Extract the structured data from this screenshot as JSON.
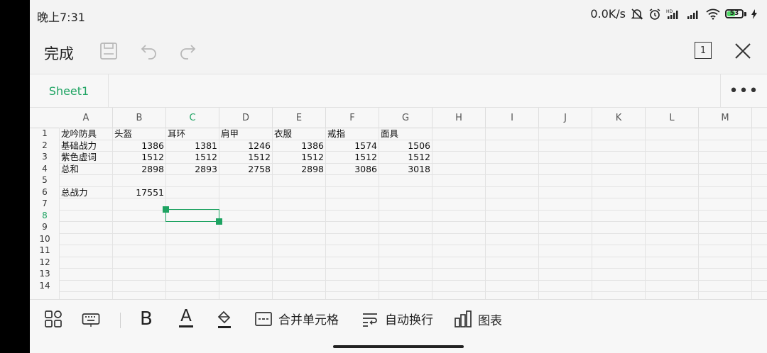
{
  "status": {
    "time": "晚上7:31",
    "speed": "0.0K/s",
    "battery": "53",
    "battery_level": 0.53
  },
  "toolbar": {
    "done_label": "完成",
    "window_count": "1",
    "icons": [
      "save-icon",
      "undo-icon",
      "redo-icon",
      "window-count-icon",
      "close-icon"
    ]
  },
  "sheets": {
    "active": "Sheet1",
    "more_label": "•••"
  },
  "spreadsheet": {
    "columns": [
      "A",
      "B",
      "C",
      "D",
      "E",
      "F",
      "G",
      "H",
      "I",
      "J",
      "K",
      "L",
      "M"
    ],
    "active_column": "C",
    "rows": [
      "1",
      "2",
      "3",
      "4",
      "5",
      "6",
      "7",
      "8",
      "9",
      "10",
      "11",
      "12",
      "13",
      "14"
    ],
    "active_row": "8",
    "selected_cell": "C8",
    "cells": {
      "A1": "龙吟防具",
      "B1": "头盔",
      "C1": "耳环",
      "D1": "肩甲",
      "E1": "衣服",
      "F1": "戒指",
      "G1": "面具",
      "A2": "基础战力",
      "B2": "1386",
      "C2": "1381",
      "D2": "1246",
      "E2": "1386",
      "F2": "1574",
      "G2": "1506",
      "A3": "紫色虚词",
      "B3": "1512",
      "C3": "1512",
      "D3": "1512",
      "E3": "1512",
      "F3": "1512",
      "G3": "1512",
      "A4": "总和",
      "B4": "2898",
      "C4": "2893",
      "D4": "2758",
      "E4": "2898",
      "F4": "3086",
      "G4": "3018",
      "A6": "总战力",
      "B6": "17551"
    }
  },
  "bottom_toolbar": {
    "bold": "B",
    "font_color": "A",
    "merge_label": "合并单元格",
    "wrap_label": "自动换行",
    "chart_label": "图表",
    "icons": [
      "grid-apps-icon",
      "keyboard-icon",
      "bold-icon",
      "font-color-icon",
      "fill-color-icon",
      "merge-cells-icon",
      "wrap-text-icon",
      "chart-icon"
    ]
  }
}
